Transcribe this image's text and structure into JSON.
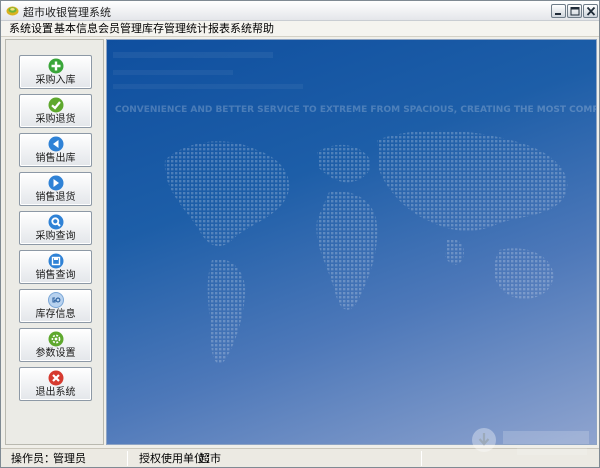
{
  "window": {
    "title": "超市收银管理系统",
    "controls": [
      "minimize",
      "maximize",
      "close"
    ]
  },
  "menu": {
    "items": [
      "系统设置",
      "基本信息",
      "会员管理",
      "库存管理",
      "统计报表",
      "系统帮助"
    ]
  },
  "sidebar": {
    "buttons": [
      {
        "label": "采购入库",
        "icon": "plus-icon",
        "color": "#3aa63a"
      },
      {
        "label": "采购退货",
        "icon": "check-icon",
        "color": "#5ea82d"
      },
      {
        "label": "销售出库",
        "icon": "arrow-left-icon",
        "color": "#2f82d6"
      },
      {
        "label": "销售退货",
        "icon": "arrow-right-icon",
        "color": "#2f82d6"
      },
      {
        "label": "采购查询",
        "icon": "magnifier-icon",
        "color": "#2f82d6"
      },
      {
        "label": "销售查询",
        "icon": "disk-icon",
        "color": "#2f82d6"
      },
      {
        "label": "库存信息",
        "icon": "go-icon",
        "color": "#7aa6d6"
      },
      {
        "label": "参数设置",
        "icon": "gear-icon",
        "color": "#5ea82d"
      },
      {
        "label": "退出系统",
        "icon": "x-icon",
        "color": "#d63a2f"
      }
    ]
  },
  "main": {
    "banner_text": "CONVENIENCE AND BETTER SERVICE TO EXTREME FROM SPACIOUS, CREATING THE MOST COMPETIT",
    "background_colors": [
      "#0f4f9f",
      "#8fa4cf"
    ]
  },
  "statusbar": {
    "operator_label": "操作员：",
    "operator_value": "管理员",
    "licensee_label": "授权使用单位：",
    "licensee_value": "超市"
  },
  "watermark": {
    "brand": "当下软件园",
    "site": "www.downxia.com"
  }
}
